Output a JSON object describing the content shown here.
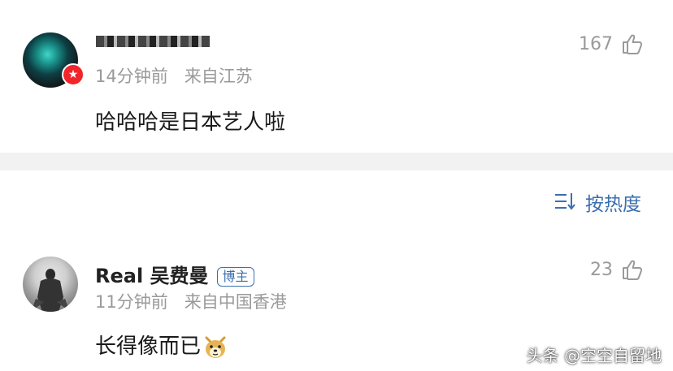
{
  "comments": [
    {
      "username": "",
      "time": "14分钟前",
      "location": "来自江苏",
      "text": "哈哈哈是日本艺人啦",
      "likes": "167"
    },
    {
      "username": "Real 吴费曼",
      "tag": "博主",
      "time": "11分钟前",
      "location": "来自中国香港",
      "text": "长得像而已",
      "likes": "23"
    }
  ],
  "sort": {
    "label": "按热度"
  },
  "watermark": {
    "text": "头条 @空空自留地"
  },
  "colors": {
    "accent": "#3a6fb0",
    "vip_badge": "#f0262a",
    "meta_text": "#9a9a9a",
    "divider": "#f2f2f2"
  }
}
